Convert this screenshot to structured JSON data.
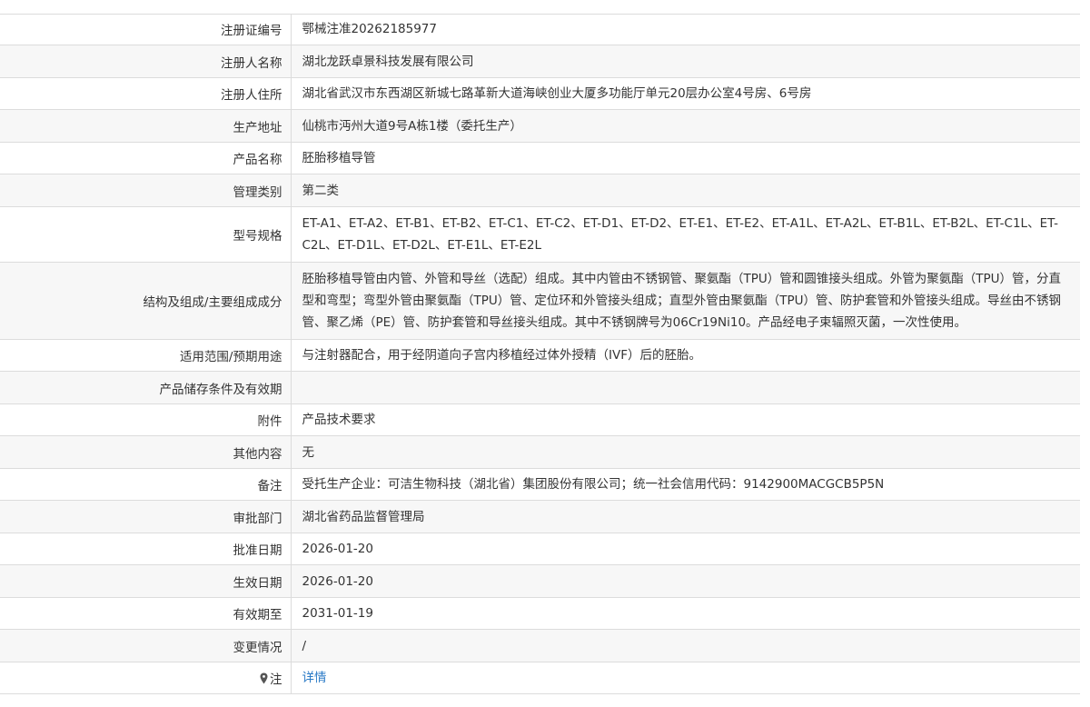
{
  "rows": [
    {
      "label": "注册证编号",
      "value": "鄂械注准20262185977"
    },
    {
      "label": "注册人名称",
      "value": "湖北龙跃卓景科技发展有限公司"
    },
    {
      "label": "注册人住所",
      "value": "湖北省武汉市东西湖区新城七路革新大道海峡创业大厦多功能厅单元20层办公室4号房、6号房"
    },
    {
      "label": "生产地址",
      "value": "仙桃市沔州大道9号A栋1楼（委托生产）"
    },
    {
      "label": "产品名称",
      "value": "胚胎移植导管"
    },
    {
      "label": "管理类别",
      "value": "第二类"
    },
    {
      "label": "型号规格",
      "value": "ET-A1、ET-A2、ET-B1、ET-B2、ET-C1、ET-C2、ET-D1、ET-D2、ET-E1、ET-E2、ET-A1L、ET-A2L、ET-B1L、ET-B2L、ET-C1L、ET-C2L、ET-D1L、ET-D2L、ET-E1L、ET-E2L"
    },
    {
      "label": "结构及组成/主要组成成分",
      "value": "胚胎移植导管由内管、外管和导丝（选配）组成。其中内管由不锈钢管、聚氨酯（TPU）管和圆锥接头组成。外管为聚氨酯（TPU）管，分直型和弯型；弯型外管由聚氨酯（TPU）管、定位环和外管接头组成；直型外管由聚氨酯（TPU）管、防护套管和外管接头组成。导丝由不锈钢管、聚乙烯（PE）管、防护套管和导丝接头组成。其中不锈钢牌号为06Cr19Ni10。产品经电子束辐照灭菌，一次性使用。"
    },
    {
      "label": "适用范围/预期用途",
      "value": "与注射器配合，用于经阴道向子宫内移植经过体外授精（IVF）后的胚胎。"
    },
    {
      "label": "产品储存条件及有效期",
      "value": ""
    },
    {
      "label": "附件",
      "value": "产品技术要求"
    },
    {
      "label": "其他内容",
      "value": "无"
    },
    {
      "label": "备注",
      "value": "受托生产企业：可洁生物科技（湖北省）集团股份有限公司；统一社会信用代码：9142900MACGCB5P5N"
    },
    {
      "label": "审批部门",
      "value": "湖北省药品监督管理局"
    },
    {
      "label": "批准日期",
      "value": "2026-01-20"
    },
    {
      "label": "生效日期",
      "value": "2026-01-20"
    },
    {
      "label": "有效期至",
      "value": "2031-01-19"
    },
    {
      "label": "变更情况",
      "value": "/"
    }
  ],
  "note_row": {
    "label": "注",
    "icon": "location-pin-icon",
    "link_text": "详情"
  },
  "colors": {
    "border": "#dcdcdc",
    "row_alt_bg": "#f7f7f7",
    "text": "#333333",
    "link": "#2b7bc7"
  }
}
